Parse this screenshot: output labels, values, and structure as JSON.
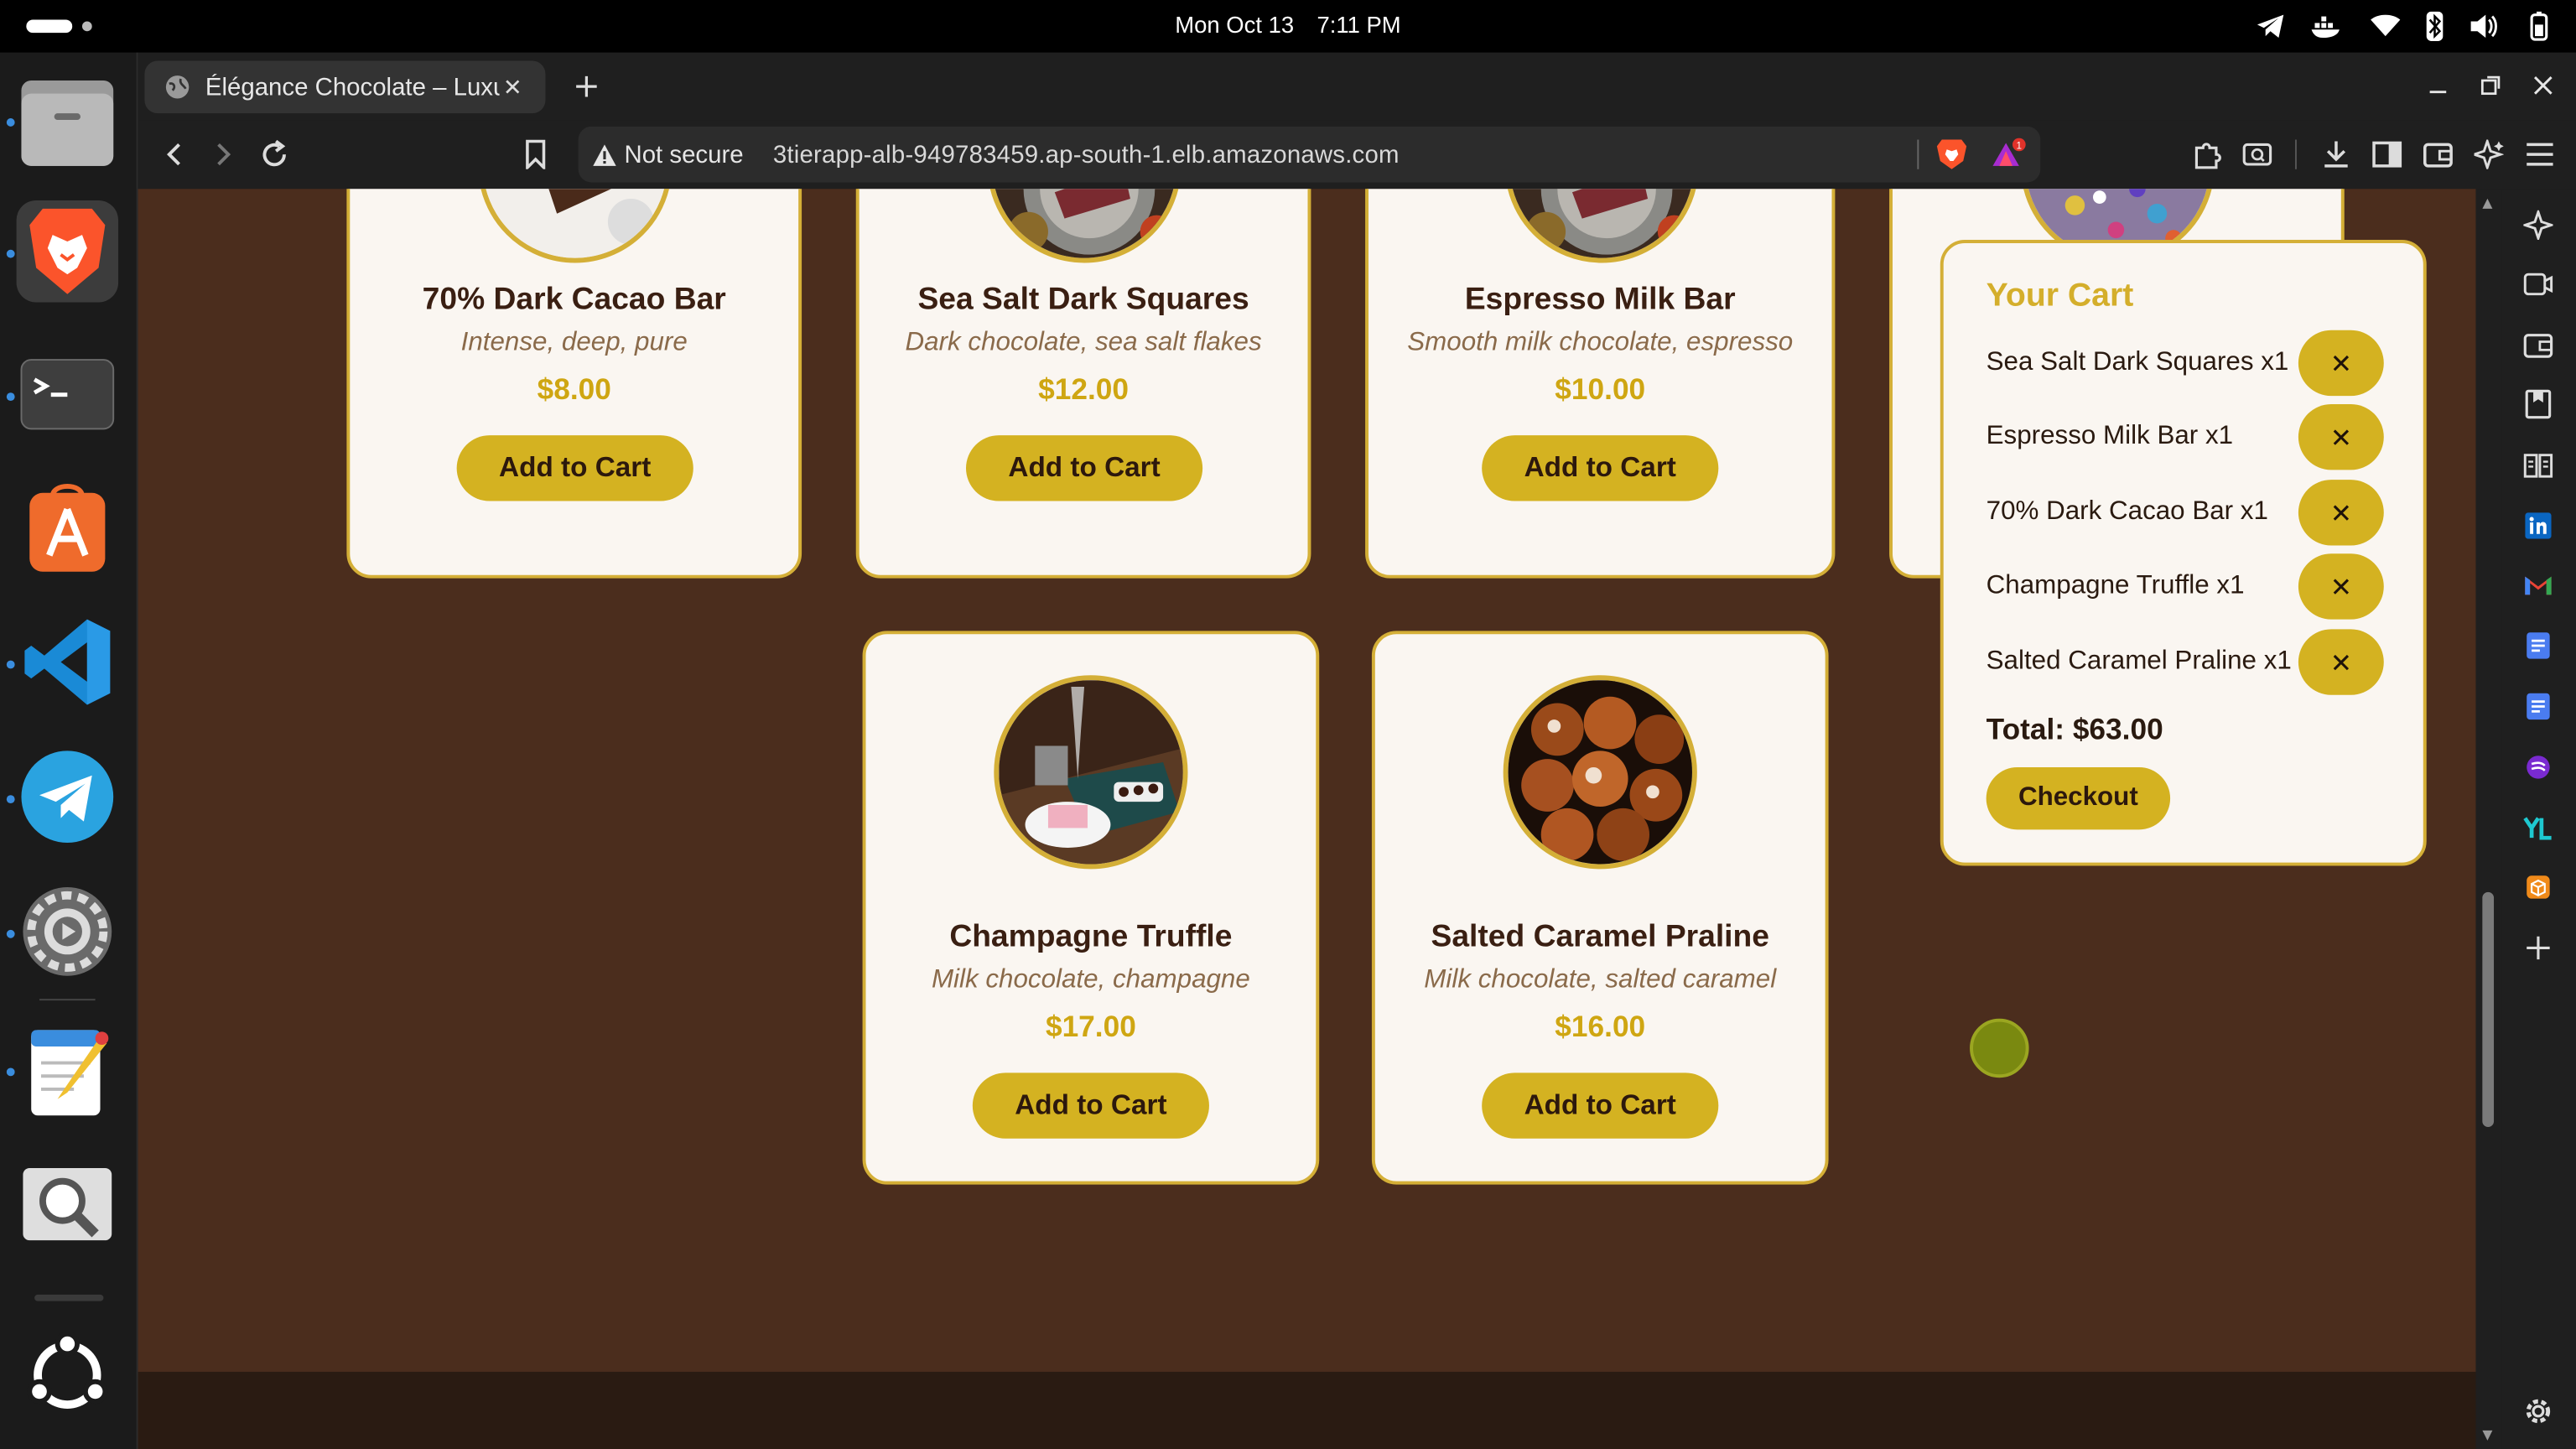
{
  "system": {
    "date": "Mon Oct 13",
    "time": "7:11 PM"
  },
  "browser": {
    "tab_title": "Élégance Chocolate – Luxury Chocolates",
    "security_label": "Not secure",
    "url": "3tierapp-alb-949783459.ap-south-1.elb.amazonaws.com",
    "rewards_badge": "1"
  },
  "products": [
    {
      "name": "70% Dark Cacao Bar",
      "desc": "Intense, deep, pure",
      "price": "$8.00",
      "button": "Add to Cart"
    },
    {
      "name": "Sea Salt Dark Squares",
      "desc": "Dark chocolate, sea salt flakes",
      "price": "$12.00",
      "button": "Add to Cart"
    },
    {
      "name": "Espresso Milk Bar",
      "desc": "Smooth milk chocolate, espresso",
      "price": "$10.00",
      "button": "Add to Cart"
    },
    {
      "name": "Champagne Truffle",
      "desc": "Milk chocolate, champagne",
      "price": "$17.00",
      "button": "Add to Cart"
    },
    {
      "name": "Salted Caramel Praline",
      "desc": "Milk chocolate, salted caramel",
      "price": "$16.00",
      "button": "Add to Cart"
    }
  ],
  "cart": {
    "title": "Your Cart",
    "items": [
      {
        "label": "Sea Salt Dark Squares x1",
        "remove": "✕"
      },
      {
        "label": "Espresso Milk Bar x1",
        "remove": "✕"
      },
      {
        "label": "70% Dark Cacao Bar x1",
        "remove": "✕"
      },
      {
        "label": "Champagne Truffle x1",
        "remove": "✕"
      },
      {
        "label": "Salted Caramel Praline x1",
        "remove": "✕"
      }
    ],
    "total": "Total: $63.00",
    "checkout": "Checkout"
  },
  "colors": {
    "page_background": "#4b2d1d",
    "accent_gold": "#d4af37",
    "card_background": "#faf6f1"
  }
}
